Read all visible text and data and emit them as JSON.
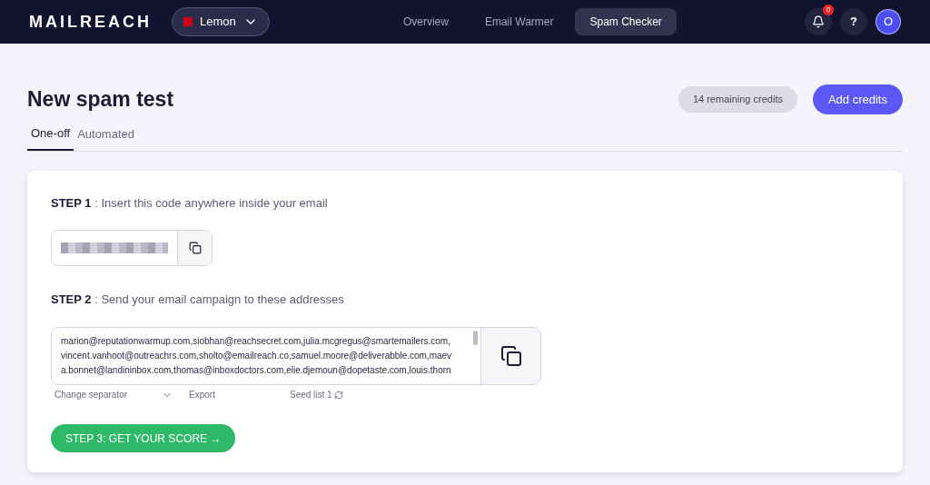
{
  "header": {
    "logo": "MAILREACH",
    "account": {
      "name": "Lemon",
      "color": "#d0021b"
    },
    "nav": [
      {
        "label": "Overview",
        "selected": false
      },
      {
        "label": "Email Warmer",
        "selected": false
      },
      {
        "label": "Spam Checker",
        "selected": true
      }
    ],
    "notifications": "0",
    "help": "?",
    "avatar": "O"
  },
  "page": {
    "title": "New spam test",
    "credits": "14 remaining credits",
    "add_button": "Add credits",
    "tabs": [
      {
        "label": "One-off",
        "selected": true
      },
      {
        "label": "Automated",
        "selected": false
      }
    ]
  },
  "step1": {
    "label": "STEP 1",
    "text": " : Insert this code anywhere inside your email"
  },
  "step2": {
    "label": "STEP 2",
    "text": " : Send your email campaign to these addresses",
    "addresses": [
      "marion@reputationwarmup.com,siobhan@reachsecret.com,julia.mcgregus@smartemailers.com,",
      "vincent.vanhoot@outreachrs.com,sholto@emailreach.co,samuel.moore@deliverabble.com,maev",
      "a.bonnet@landininbox.com,thomas@inboxdoctors.com,elie.djemoun@dopetaste.com,louis.thorn"
    ],
    "separator": "Change separator",
    "export": "Export",
    "seed_list": "Seed list 1"
  },
  "submit": "STEP 3: GET YOUR SCORE →"
}
